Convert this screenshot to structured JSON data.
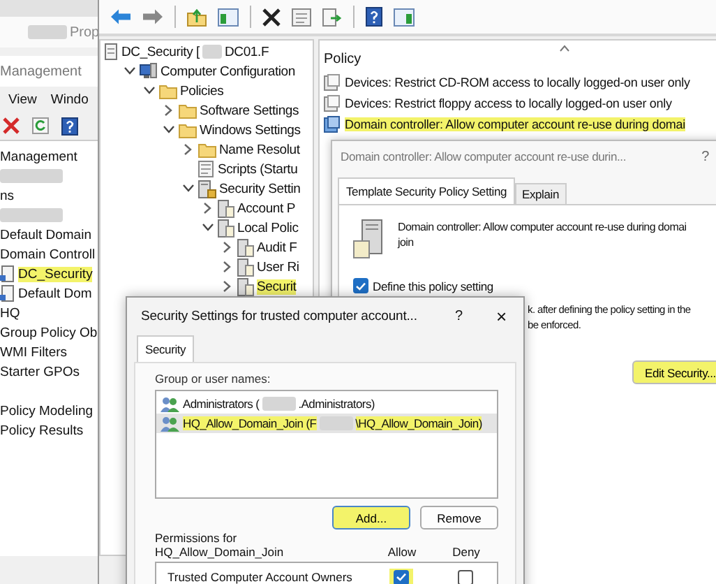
{
  "gpmc_window": {
    "tab_label": "Prop",
    "title": "Management",
    "menu": [
      "View",
      "Windo"
    ],
    "tree": [
      {
        "kind": "text",
        "label": "Management",
        "highlighted": false
      },
      {
        "kind": "redacted"
      },
      {
        "kind": "text",
        "label": "ns",
        "highlighted": false
      },
      {
        "kind": "redacted"
      },
      {
        "kind": "text",
        "label": "Default Domain",
        "highlighted": false
      },
      {
        "kind": "text",
        "label": "Domain Controll",
        "highlighted": false
      },
      {
        "kind": "gpo",
        "label": "DC_Security",
        "highlighted": true
      },
      {
        "kind": "gpo",
        "label": "Default Dom",
        "highlighted": false
      },
      {
        "kind": "text",
        "label": "HQ",
        "highlighted": false
      },
      {
        "kind": "text",
        "label": "Group Policy Ob",
        "highlighted": false
      },
      {
        "kind": "text",
        "label": "WMI Filters",
        "highlighted": false
      },
      {
        "kind": "text",
        "label": "Starter GPOs",
        "highlighted": false
      },
      {
        "kind": "spacer"
      },
      {
        "kind": "text",
        "label": "Policy Modeling",
        "highlighted": false
      },
      {
        "kind": "text",
        "label": "Policy Results",
        "highlighted": false
      }
    ]
  },
  "editor_window": {
    "tree": [
      {
        "kind": "document",
        "parts": [
          "DC_Security [",
          "DC01.F"
        ],
        "highlighted": false,
        "children": [
          {
            "kind": "computer",
            "parts": [
              "Computer Configuration"
            ],
            "expanded": true,
            "highlighted": false,
            "children": [
              {
                "kind": "folder",
                "parts": [
                  "Policies"
                ],
                "expanded": true,
                "highlighted": false,
                "children": [
                  {
                    "kind": "folder",
                    "parts": [
                      "Software Settings"
                    ],
                    "expanded": false,
                    "highlighted": false
                  },
                  {
                    "kind": "folder",
                    "parts": [
                      "Windows Settings"
                    ],
                    "expanded": true,
                    "highlighted": false,
                    "children": [
                      {
                        "kind": "folder",
                        "parts": [
                          "Name Resolut"
                        ],
                        "expanded": false,
                        "highlighted": false
                      },
                      {
                        "kind": "script",
                        "parts": [
                          "Scripts (Startu"
                        ],
                        "highlighted": false
                      },
                      {
                        "kind": "security",
                        "parts": [
                          "Security Settin"
                        ],
                        "expanded": true,
                        "highlighted": false,
                        "children": [
                          {
                            "kind": "policy",
                            "parts": [
                              "Account P"
                            ],
                            "expanded": false,
                            "highlighted": false
                          },
                          {
                            "kind": "policy",
                            "parts": [
                              "Local Polic"
                            ],
                            "expanded": true,
                            "highlighted": false,
                            "children": [
                              {
                                "kind": "policy",
                                "parts": [
                                  "Audit F"
                                ],
                                "expanded": false,
                                "highlighted": false
                              },
                              {
                                "kind": "policy",
                                "parts": [
                                  "User Ri"
                                ],
                                "expanded": false,
                                "highlighted": false
                              },
                              {
                                "kind": "policy",
                                "parts": [
                                  "Securit"
                                ],
                                "expanded": false,
                                "highlighted": true
                              }
                            ]
                          }
                        ]
                      }
                    ]
                  }
                ]
              }
            ]
          }
        ]
      }
    ],
    "policy_header": "Policy",
    "policies": [
      {
        "label": "Devices: Restrict CD-ROM access to locally logged-on user only",
        "selected": false,
        "highlighted": false
      },
      {
        "label": "Devices: Restrict floppy access to locally logged-on user only",
        "selected": false,
        "highlighted": false
      },
      {
        "label": "Domain controller: Allow computer account re-use during domai",
        "selected": true,
        "highlighted": true
      }
    ]
  },
  "properties_dialog": {
    "title": "Domain controller: Allow computer account re-use durin...",
    "help": "?",
    "tabs": [
      {
        "label": "Template Security Policy Setting",
        "selected": true
      },
      {
        "label": "Explain",
        "selected": false
      }
    ],
    "description_lines": [
      "Domain controller: Allow computer account re-use during domai",
      "join"
    ],
    "define_setting": {
      "label": "Define this policy setting",
      "checked": true
    },
    "note_lines": [
      "k. after defining the policy setting in the",
      "be enforced."
    ],
    "edit_button": {
      "label": "Edit Security...",
      "highlighted": true
    }
  },
  "security_dialog": {
    "title": "Security Settings for trusted computer account...",
    "help": "?",
    "close": "×",
    "tabs": [
      {
        "label": "Security",
        "selected": true
      }
    ],
    "group_label": "Group or user names:",
    "members": [
      {
        "parts": [
          "Administrators (",
          ".Administrators)"
        ],
        "selected": false,
        "highlighted": false
      },
      {
        "parts": [
          "HQ_Allow_Domain_Join (F",
          "\\HQ_Allow_Domain_Join)"
        ],
        "selected": true,
        "highlighted": true
      }
    ],
    "buttons": [
      {
        "label": "Add...",
        "highlighted": true
      },
      {
        "label": "Remove",
        "highlighted": false
      }
    ],
    "permissions_label": [
      "Permissions for",
      "HQ_Allow_Domain_Join"
    ],
    "columns": [
      "Allow",
      "Deny"
    ],
    "permissions": [
      {
        "name": "Trusted Computer Account Owners",
        "allow": {
          "checked": true,
          "highlighted": true
        },
        "deny": {
          "checked": false
        }
      }
    ]
  }
}
